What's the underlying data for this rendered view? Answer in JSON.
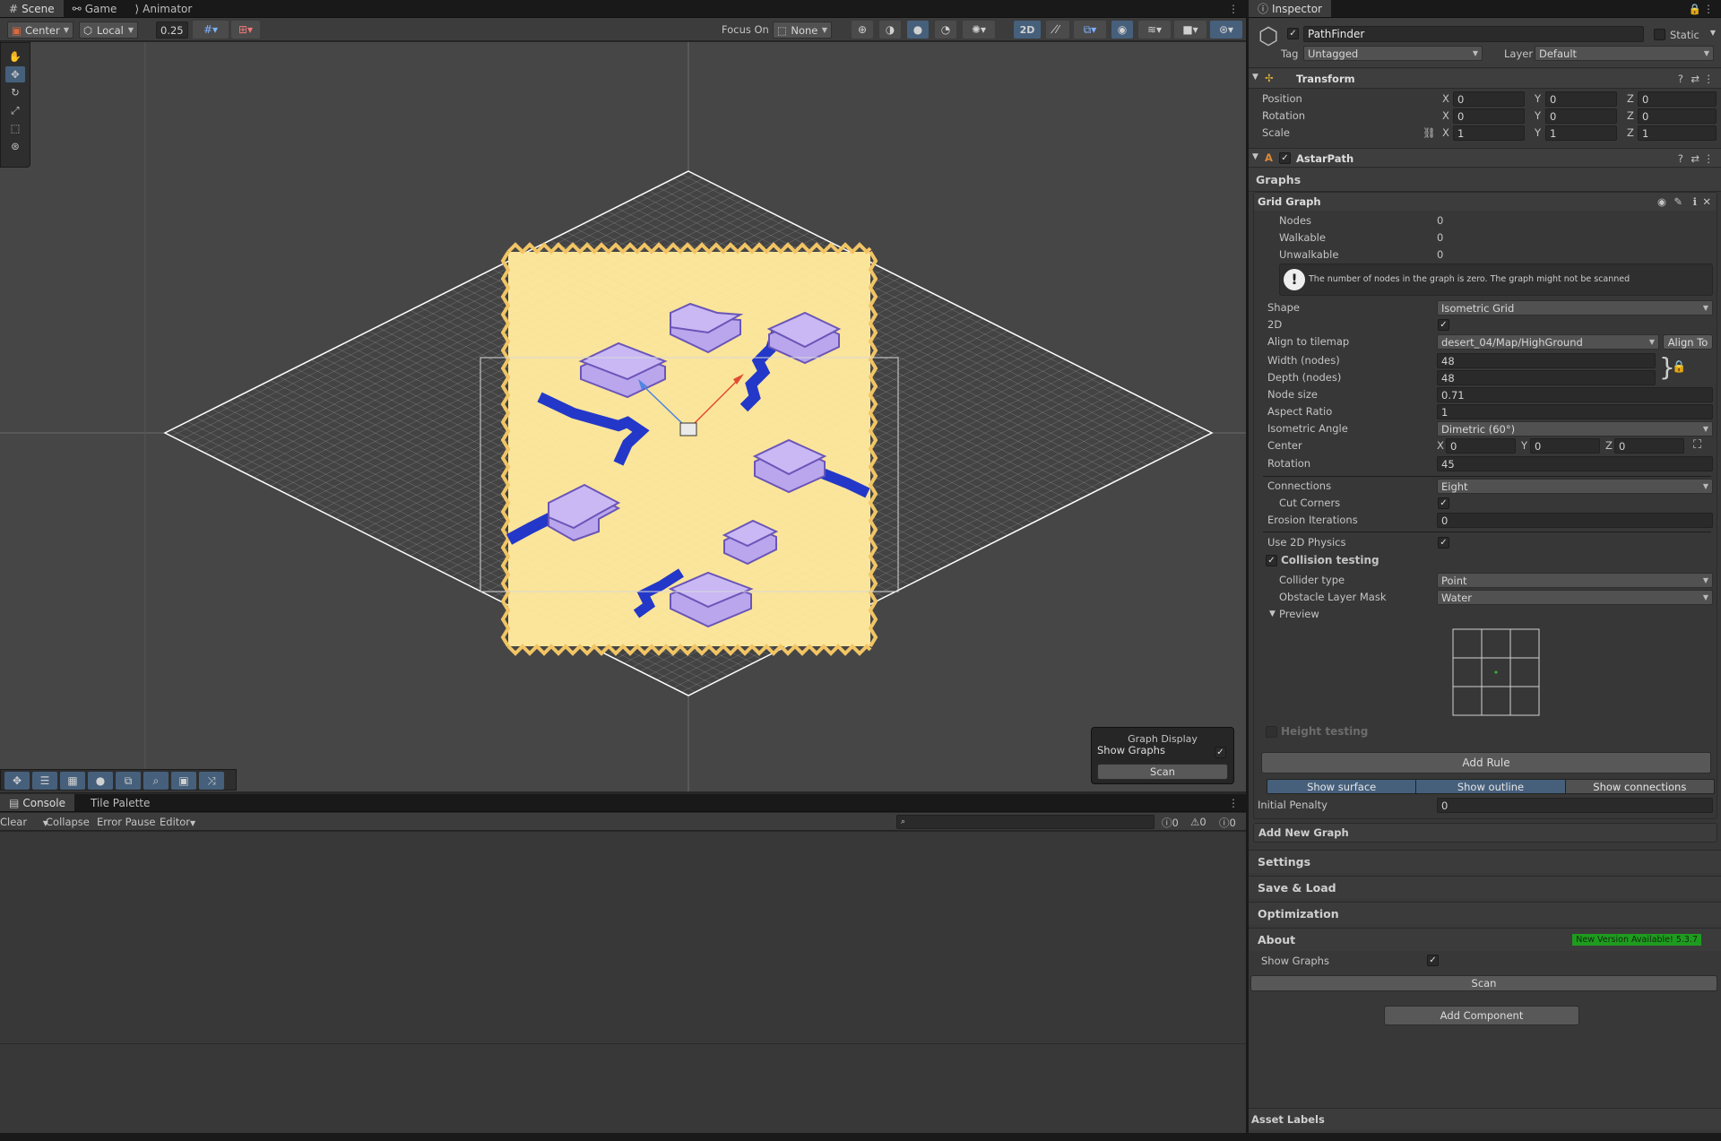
{
  "scene_tabs": [
    {
      "label": "Scene",
      "icon": "grid-icon"
    },
    {
      "label": "Game",
      "icon": "gamepad-icon"
    },
    {
      "label": "Animator",
      "icon": "animator-icon"
    }
  ],
  "toolbar": {
    "pivot": "Center",
    "space": "Local",
    "snap": "0.25",
    "focus_on_label": "Focus On",
    "focus_value": "None",
    "mode_2d": "2D"
  },
  "overlay": {
    "title": "Graph Display",
    "show_graphs": "Show Graphs",
    "scan": "Scan"
  },
  "bottom_tabs": [
    {
      "label": "Console"
    },
    {
      "label": "Tile Palette"
    }
  ],
  "console": {
    "clear": "Clear",
    "collapse": "Collapse",
    "error_pause": "Error Pause",
    "editor": "Editor",
    "counts": [
      "0",
      "0",
      "0"
    ]
  },
  "inspector": {
    "tab": "Inspector",
    "object_name": "PathFinder",
    "static_label": "Static",
    "tag_label": "Tag",
    "tag_value": "Untagged",
    "layer_label": "Layer",
    "layer_value": "Default",
    "transform": {
      "title": "Transform",
      "position": {
        "label": "Position",
        "x": "0",
        "y": "0",
        "z": "0"
      },
      "rotation": {
        "label": "Rotation",
        "x": "0",
        "y": "0",
        "z": "0"
      },
      "scale": {
        "label": "Scale",
        "x": "1",
        "y": "1",
        "z": "1"
      }
    },
    "astar": {
      "title": "AstarPath",
      "graphs_label": "Graphs",
      "grid_graph": "Grid Graph",
      "nodes": {
        "label": "Nodes",
        "value": "0"
      },
      "walkable": {
        "label": "Walkable",
        "value": "0"
      },
      "unwalkable": {
        "label": "Unwalkable",
        "value": "0"
      },
      "warning": "The number of nodes in the graph is zero. The graph might not be scanned",
      "shape": {
        "label": "Shape",
        "value": "Isometric Grid"
      },
      "twod": {
        "label": "2D"
      },
      "align": {
        "label": "Align to tilemap",
        "value": "desert_04/Map/HighGround",
        "button": "Align To"
      },
      "width": {
        "label": "Width (nodes)",
        "value": "48"
      },
      "depth": {
        "label": "Depth (nodes)",
        "value": "48"
      },
      "node_size": {
        "label": "Node size",
        "value": "0.71"
      },
      "aspect": {
        "label": "Aspect Ratio",
        "value": "1"
      },
      "iso_angle": {
        "label": "Isometric Angle",
        "value": "Dimetric (60°)"
      },
      "center": {
        "label": "Center",
        "x": "0",
        "y": "0",
        "z": "0"
      },
      "rotation": {
        "label": "Rotation",
        "value": "45"
      },
      "connections": {
        "label": "Connections",
        "value": "Eight"
      },
      "cut_corners": {
        "label": "Cut Corners"
      },
      "erosion": {
        "label": "Erosion Iterations",
        "value": "0"
      },
      "use2d": {
        "label": "Use 2D Physics"
      },
      "collision": {
        "label": "Collision testing"
      },
      "collider_type": {
        "label": "Collider type",
        "value": "Point"
      },
      "obstacle_mask": {
        "label": "Obstacle Layer Mask",
        "value": "Water"
      },
      "preview": {
        "label": "Preview"
      },
      "height_testing": {
        "label": "Height testing"
      },
      "add_rule": "Add Rule",
      "show_surface": "Show surface",
      "show_outline": "Show outline",
      "show_connections": "Show connections",
      "initial_penalty": {
        "label": "Initial Penalty",
        "value": "0"
      },
      "add_new_graph": "Add New Graph",
      "sections": [
        "Settings",
        "Save & Load",
        "Optimization",
        "About"
      ],
      "new_version": "New Version Available! 5.3.7",
      "show_graphs": "Show Graphs",
      "scan": "Scan"
    },
    "add_component": "Add Component",
    "asset_labels": "Asset Labels"
  },
  "colors": {
    "sand": "#fbe59a",
    "sand_edge": "#f5cf6a",
    "water": "#2338c8",
    "grid": "#cfcfcf",
    "accent": "#46607c",
    "green": "#1f9c1f"
  }
}
